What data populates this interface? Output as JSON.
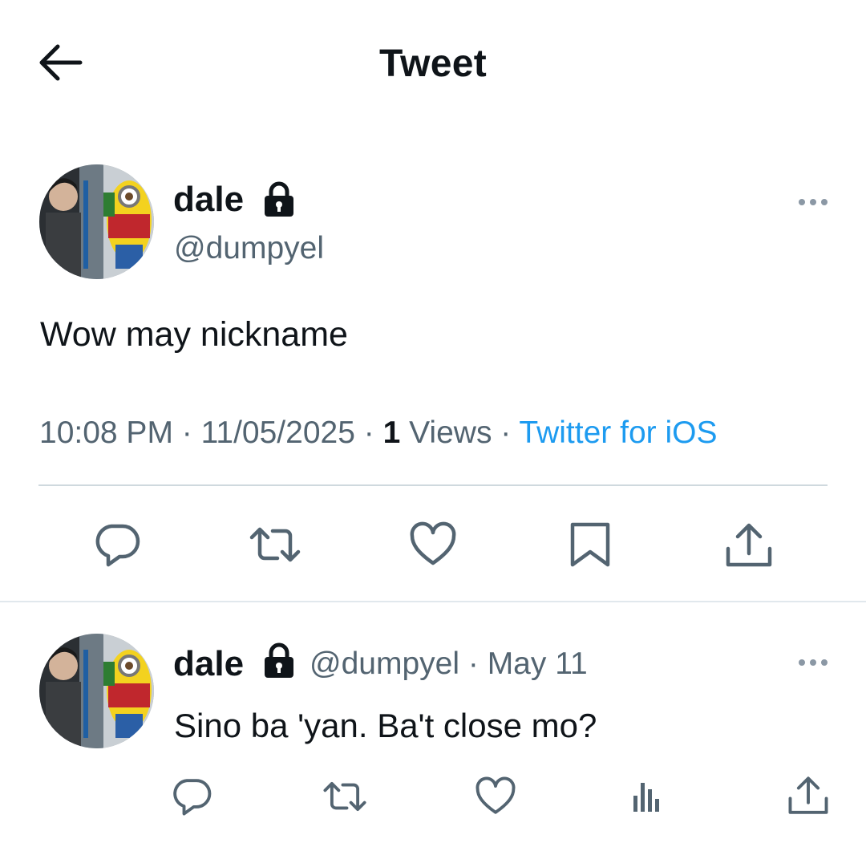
{
  "header": {
    "title": "Tweet",
    "back_icon": "arrow-left-icon"
  },
  "tweet": {
    "display_name": "dale",
    "handle": "@dumpyel",
    "protected_icon": "lock-icon",
    "text": "Wow may nickname",
    "time": "10:08 PM",
    "date": "11/05/2025",
    "views_count": "1",
    "views_label": "Views",
    "source": "Twitter for iOS",
    "actions": [
      "reply-icon",
      "retweet-icon",
      "like-icon",
      "bookmark-icon",
      "share-icon"
    ]
  },
  "reply": {
    "display_name": "dale",
    "handle": "@dumpyel",
    "date": "May 11",
    "text": "Sino ba 'yan. Ba't close mo?",
    "actions": [
      "reply-icon",
      "retweet-icon",
      "like-icon",
      "views-icon",
      "share-icon"
    ]
  },
  "colors": {
    "text": "#0f1419",
    "secondary": "#536471",
    "link": "#1d9bf0",
    "divider": "#cfd9de"
  }
}
